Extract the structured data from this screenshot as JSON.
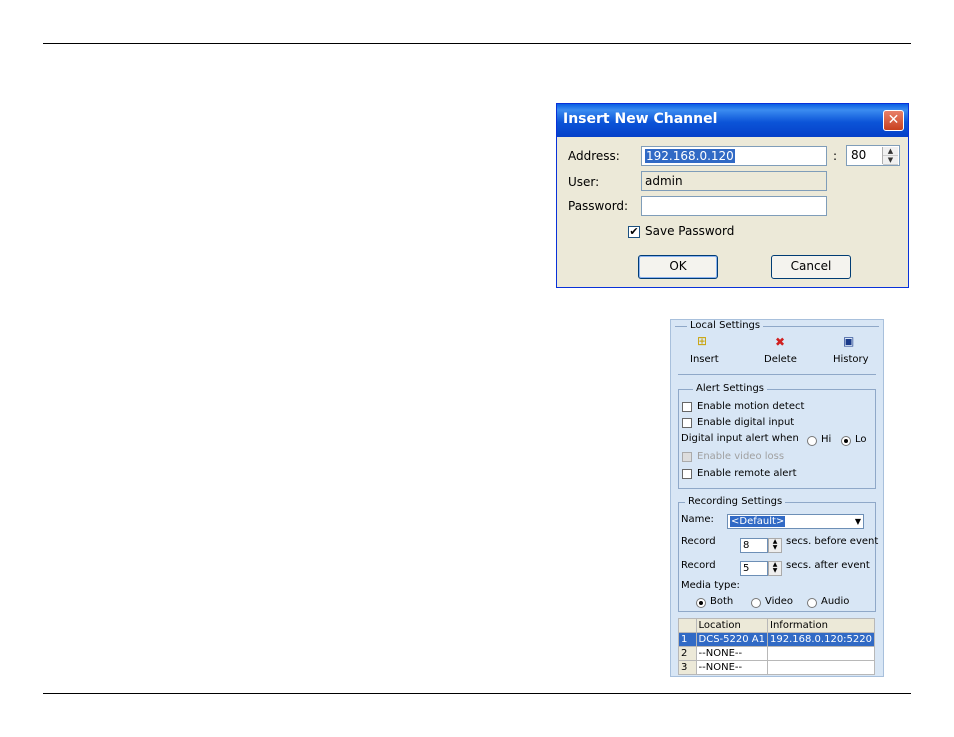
{
  "dialog": {
    "title": "Insert New Channel",
    "close_glyph": "✕",
    "address_label": "Address:",
    "address_value": "192.168.0.120",
    "port_separator": ":",
    "port_value": "80",
    "user_label": "User:",
    "user_value": "admin",
    "password_label": "Password:",
    "password_value": "",
    "save_password_label": "Save Password",
    "save_password_checked": true,
    "ok_label": "OK",
    "cancel_label": "Cancel"
  },
  "panel": {
    "title": "Local Settings",
    "toolbar": [
      {
        "label": "Insert",
        "icon": "insert-icon"
      },
      {
        "label": "Delete",
        "icon": "delete-icon"
      },
      {
        "label": "History",
        "icon": "history-icon"
      }
    ],
    "alert": {
      "title": "Alert Settings",
      "motion_label": "Enable motion detect",
      "digital_label": "Enable digital input",
      "digital_when_label": "Digital input alert when",
      "hi_label": "Hi",
      "lo_label": "Lo",
      "selected_level": "Lo",
      "video_loss_label": "Enable video loss",
      "remote_label": "Enable remote alert"
    },
    "recording": {
      "title": "Recording Settings",
      "name_label": "Name:",
      "name_value": "<Default>",
      "record_label": "Record",
      "before_value": "8",
      "before_suffix": "secs. before event",
      "after_value": "5",
      "after_suffix": "secs. after event",
      "media_type_label": "Media type:",
      "media_options": [
        "Both",
        "Video",
        "Audio"
      ],
      "media_selected": "Both"
    },
    "table": {
      "columns": [
        "",
        "Location",
        "Information"
      ],
      "rows": [
        {
          "num": "1",
          "location": "DCS-5220   A1",
          "info": "192.168.0.120:5220"
        },
        {
          "num": "2",
          "location": "--NONE--",
          "info": ""
        },
        {
          "num": "3",
          "location": "--NONE--",
          "info": ""
        }
      ]
    }
  }
}
